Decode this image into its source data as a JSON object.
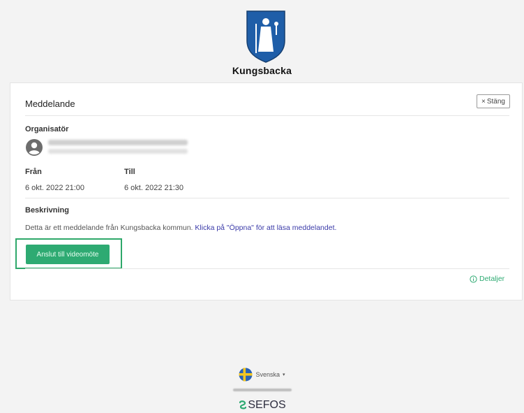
{
  "header": {
    "brand": "Kungsbacka"
  },
  "message": {
    "title": "Meddelande",
    "close_label": "Stäng",
    "organizer_label": "Organisatör",
    "from_label": "Från",
    "from_value": "6 okt. 2022 21:00",
    "to_label": "Till",
    "to_value": "6 okt. 2022 21:30",
    "description_label": "Beskrivning",
    "description_text": "Detta är ett meddelande från Kungsbacka kommun.",
    "description_link": "Klicka på \"Öppna\" för att läsa meddelandet.",
    "join_button": "Anslut till videomöte",
    "details_link": "Detaljer"
  },
  "footer": {
    "language": "Svenska",
    "brand": "SEFOS"
  },
  "colors": {
    "accent": "#2eaa72",
    "focus": "#2ea86a",
    "crest_blue": "#1f5ea8"
  },
  "icons": {
    "crest": "kungsbacka-crest-icon",
    "avatar": "user-avatar-icon",
    "close": "close-icon",
    "info": "info-icon",
    "flag": "sweden-flag-icon",
    "dropdown": "caret-down-icon",
    "sefos": "sefos-logo-icon"
  }
}
